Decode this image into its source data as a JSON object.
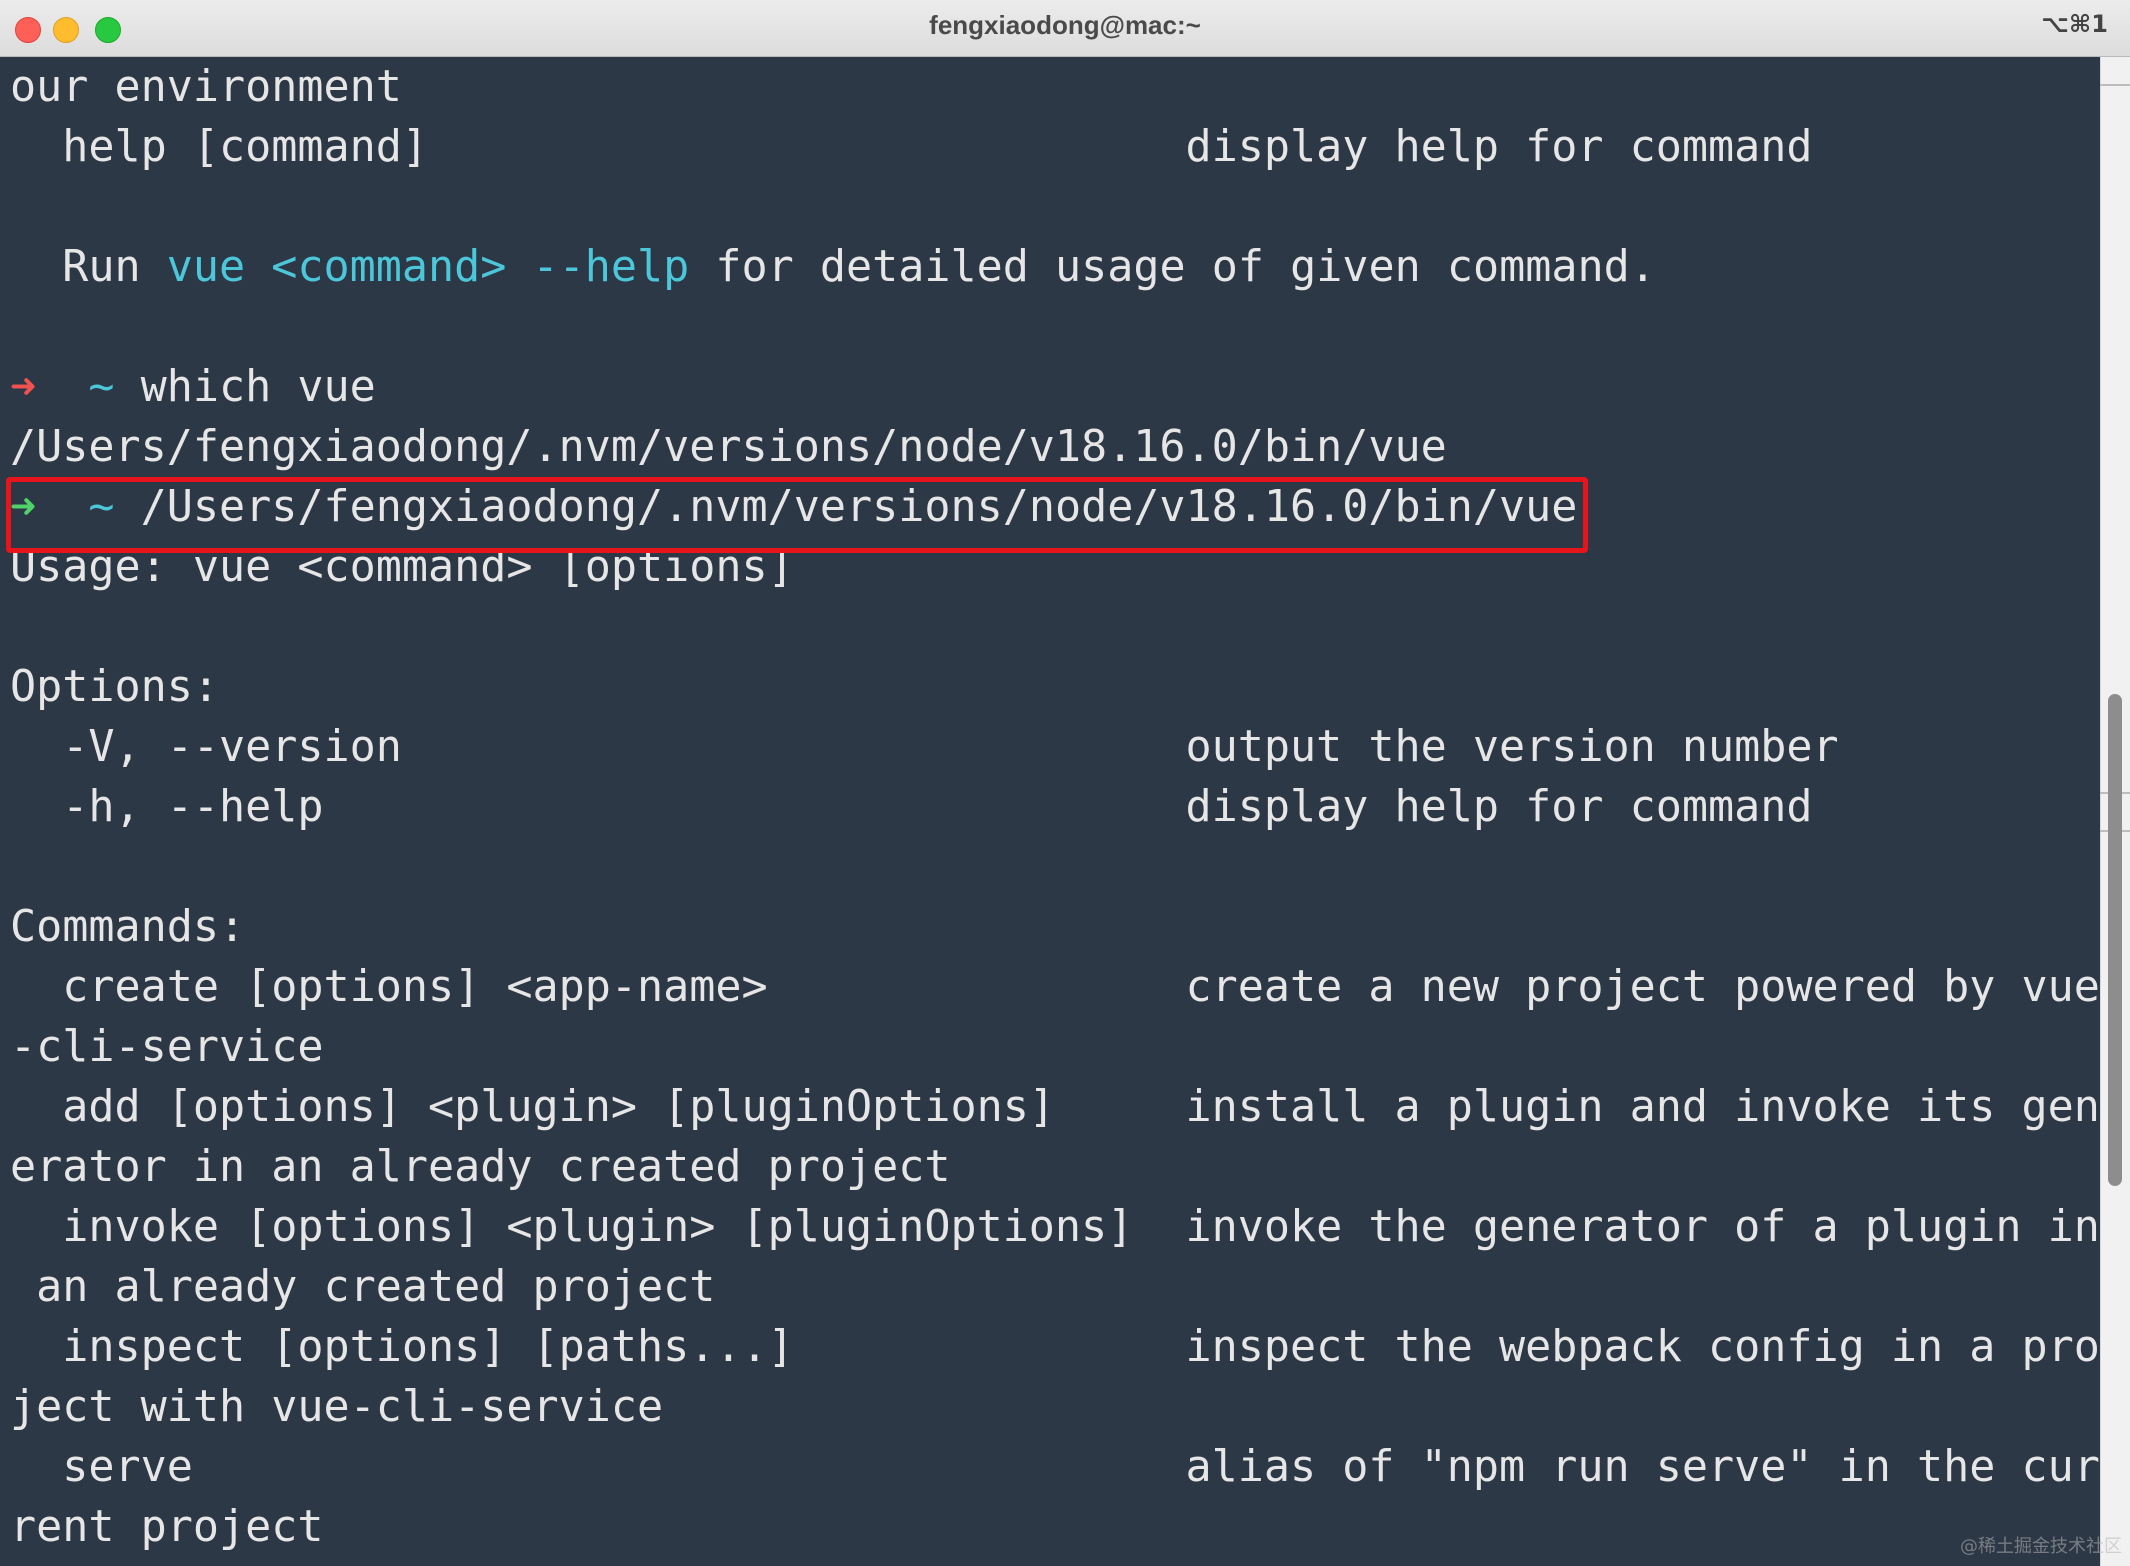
{
  "window": {
    "title": "fengxiaodong@mac:~",
    "shortcut": "⌥⌘1"
  },
  "terminal": {
    "l1": "our environment",
    "l2": "  help [command]                             display help for command",
    "l4_pre": "  Run ",
    "l4_vue": "vue",
    "l4_sp1": " ",
    "l4_cmd": "<command>",
    "l4_sp2": " ",
    "l4_help": "--help",
    "l4_post": " for detailed usage of given command.",
    "l6_arrow": "➜",
    "l6_tilde": "  ~",
    "l6_cmd": " which vue",
    "l7": "/Users/fengxiaodong/.nvm/versions/node/v18.16.0/bin/vue",
    "l8_arrow": "➜",
    "l8_tilde": "  ~",
    "l8_cmd": " /Users/fengxiaodong/.nvm/versions/node/v18.16.0/bin/vue",
    "l9": "Usage: vue <command> [options]",
    "l11": "Options:",
    "l12": "  -V, --version                              output the version number",
    "l13": "  -h, --help                                 display help for command",
    "l15": "Commands:",
    "l16": "  create [options] <app-name>                create a new project powered by vue",
    "l17": "-cli-service",
    "l18": "  add [options] <plugin> [pluginOptions]     install a plugin and invoke its gen",
    "l19": "erator in an already created project",
    "l20": "  invoke [options] <plugin> [pluginOptions]  invoke the generator of a plugin in",
    "l21": " an already created project",
    "l22": "  inspect [options] [paths...]               inspect the webpack config in a pro",
    "l23": "ject with vue-cli-service",
    "l24": "  serve                                      alias of \"npm run serve\" in the cur",
    "l25": "rent project"
  },
  "watermark": "@稀土掘金技术社区",
  "colors": {
    "background": "#2d3846",
    "foreground": "#e6e6e6",
    "accent_cyan": "#4cc7da",
    "prompt_error_red": "#f0524f",
    "prompt_ok_green": "#4fd26a",
    "highlight_box": "#e8141c"
  }
}
